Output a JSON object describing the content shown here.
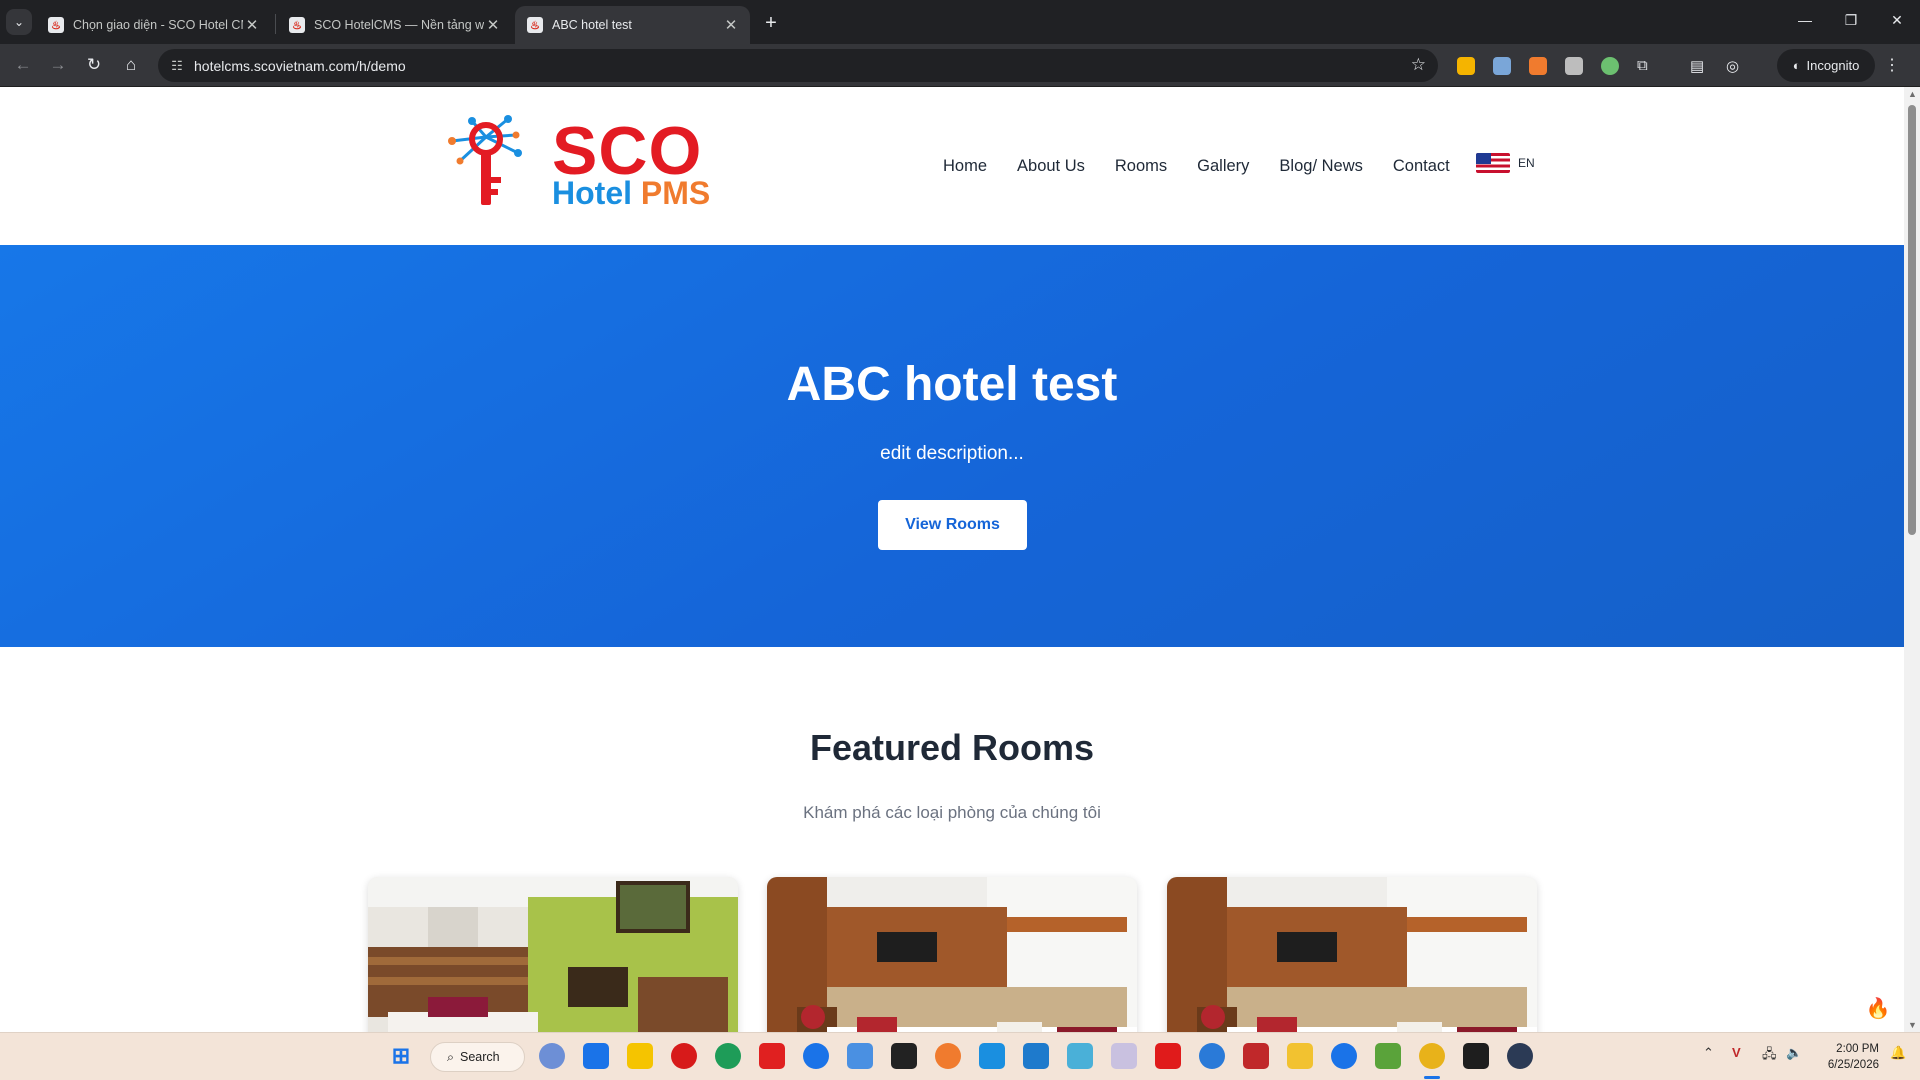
{
  "browser": {
    "tabs": [
      {
        "title": "Chọn giao diện - SCO Hotel CMS",
        "active": false
      },
      {
        "title": "SCO HotelCMS — Nền tảng website",
        "active": false
      },
      {
        "title": "ABC hotel test",
        "active": true
      }
    ],
    "new_tab_label": "+",
    "url": "hotelcms.scovietnam.com/h/demo",
    "incognito_label": "Incognito"
  },
  "site": {
    "logo": {
      "brand": "SCO",
      "sub_hotel": "Hotel",
      "sub_pms": "PMS"
    },
    "nav": [
      "Home",
      "About Us",
      "Rooms",
      "Gallery",
      "Blog/ News",
      "Contact"
    ],
    "language": "EN"
  },
  "hero": {
    "title": "ABC hotel test",
    "description": "edit description...",
    "button": "View Rooms"
  },
  "featured": {
    "title": "Featured Rooms",
    "subtitle": "Khám phá các loại phòng của chúng tôi"
  },
  "taskbar": {
    "search_label": "Search",
    "time": "2:00 PM",
    "date": "6/25/2026"
  },
  "colors": {
    "hero_bg": "#1565d8",
    "brand_red": "#e31b23",
    "brand_blue": "#1a8fe0",
    "brand_orange": "#f07b2e"
  }
}
